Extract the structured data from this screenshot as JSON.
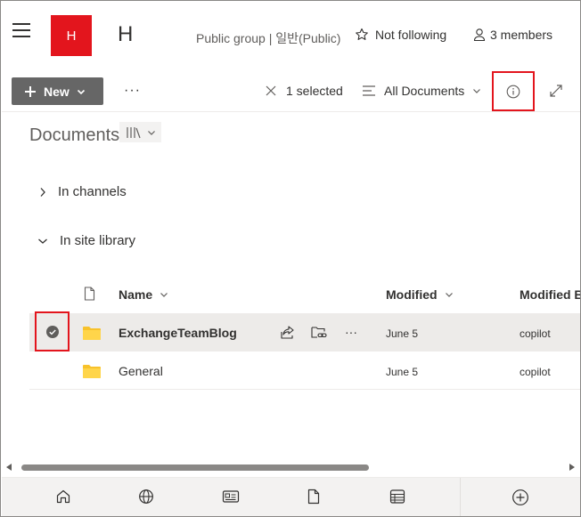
{
  "header": {
    "logo_letter": "H",
    "site_title": "H",
    "group_info": "Public group | 일반(Public)",
    "follow_label": "Not following",
    "members_label": "3 members"
  },
  "commandbar": {
    "new_label": "New",
    "more_label": "···",
    "selected_label": "1 selected",
    "view_label": "All Documents"
  },
  "breadcrumb": {
    "title": "Documents"
  },
  "groups": [
    {
      "label": "In channels",
      "expanded": false
    },
    {
      "label": "In site library",
      "expanded": true
    }
  ],
  "table": {
    "columns": {
      "name": "Name",
      "modified": "Modified",
      "modified_by": "Modified B"
    },
    "rows": [
      {
        "name": "ExchangeTeamBlog",
        "modified": "June 5",
        "modified_by": "copilot",
        "selected": true
      },
      {
        "name": "General",
        "modified": "June 5",
        "modified_by": "copilot",
        "selected": false
      }
    ]
  },
  "scrollbar": {
    "position": 0,
    "visible_fraction": 0.62
  },
  "colors": {
    "brand": "#e3151d",
    "new_button": "#666666",
    "selected_row": "#edebe9",
    "folder": "#f8c22b"
  },
  "icons": {
    "nav": [
      "home-icon",
      "globe-icon",
      "news-icon",
      "file-icon",
      "list-icon",
      "add-icon"
    ]
  }
}
